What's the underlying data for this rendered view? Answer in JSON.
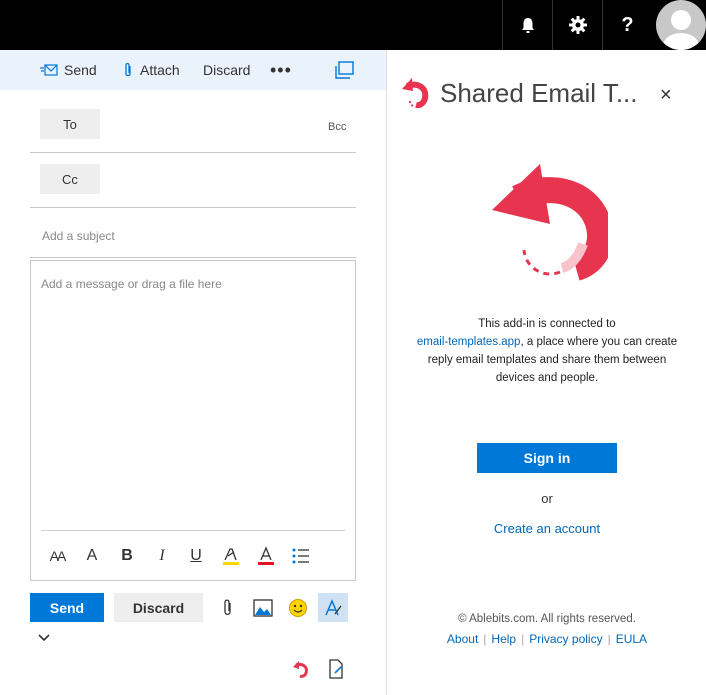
{
  "topbar": {
    "help_label": "?",
    "icons": [
      "bell-icon",
      "gear-icon",
      "question-icon",
      "avatar"
    ]
  },
  "compose": {
    "toolbar": {
      "send_label": "Send",
      "attach_label": "Attach",
      "discard_label": "Discard",
      "more_label": "•••"
    },
    "to_label": "To",
    "bcc_label": "Bcc",
    "cc_label": "Cc",
    "subject_placeholder": "Add a subject",
    "body_placeholder": "Add a message or drag a file here",
    "format": {
      "font_size": "AA",
      "font": "A",
      "bold": "B",
      "italic": "I",
      "underline": "U",
      "font_color": "A"
    },
    "send_button": "Send",
    "discard_button": "Discard"
  },
  "panel": {
    "title": "Shared Email T...",
    "close": "×",
    "text_before": "This add-in is connected to",
    "link": "email-templates.app",
    "text_after": ", a place where you can create reply email templates and share them between devices and people.",
    "signin": "Sign in",
    "or": "or",
    "create_account": "Create an account",
    "copyright": "© Ablebits.com. All rights reserved.",
    "links": [
      "About",
      "Help",
      "Privacy policy",
      "EULA"
    ]
  },
  "colors": {
    "accent": "#0078d7",
    "brand": "#e8354f",
    "topbar": "#000000"
  }
}
